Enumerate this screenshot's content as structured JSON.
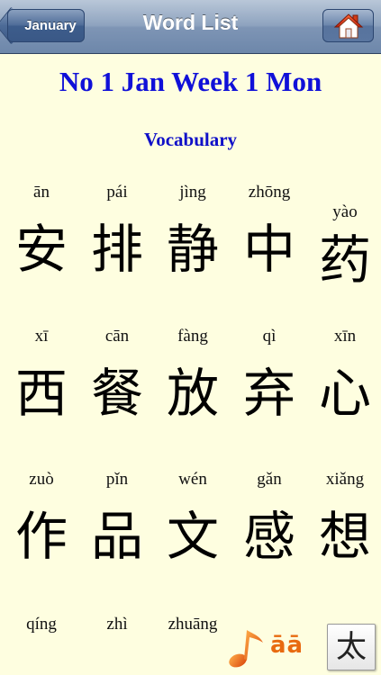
{
  "navbar": {
    "back_label": "January",
    "title": "Word List",
    "home_icon": "home-icon"
  },
  "lesson_title": "No 1 Jan Week 1 Mon",
  "section_title": "Vocabulary",
  "words": [
    {
      "pinyin": "ān",
      "hanzi": "安"
    },
    {
      "pinyin": "pái",
      "hanzi": "排"
    },
    {
      "pinyin": "jìng",
      "hanzi": "静"
    },
    {
      "pinyin": "zhōng",
      "hanzi": "中"
    },
    {
      "pinyin": "yào",
      "hanzi": "药"
    },
    {
      "pinyin": "xī",
      "hanzi": "西"
    },
    {
      "pinyin": "cān",
      "hanzi": "餐"
    },
    {
      "pinyin": "fàng",
      "hanzi": "放"
    },
    {
      "pinyin": "qì",
      "hanzi": "弃"
    },
    {
      "pinyin": "xīn",
      "hanzi": "心"
    },
    {
      "pinyin": "zuò",
      "hanzi": "作"
    },
    {
      "pinyin": "pǐn",
      "hanzi": "品"
    },
    {
      "pinyin": "wén",
      "hanzi": "文"
    },
    {
      "pinyin": "gǎn",
      "hanzi": "感"
    },
    {
      "pinyin": "xiǎng",
      "hanzi": "想"
    },
    {
      "pinyin": "qíng",
      "hanzi": ""
    },
    {
      "pinyin": "zhì",
      "hanzi": ""
    },
    {
      "pinyin": "zhuāng",
      "hanzi": ""
    }
  ],
  "toolbar": {
    "audio_icon": "music-note-icon",
    "tone_label": "āā",
    "dict_char": "太"
  },
  "colors": {
    "background": "#fefee0",
    "title_blue": "#1010d8",
    "nav_blue": "#6d87aa"
  }
}
